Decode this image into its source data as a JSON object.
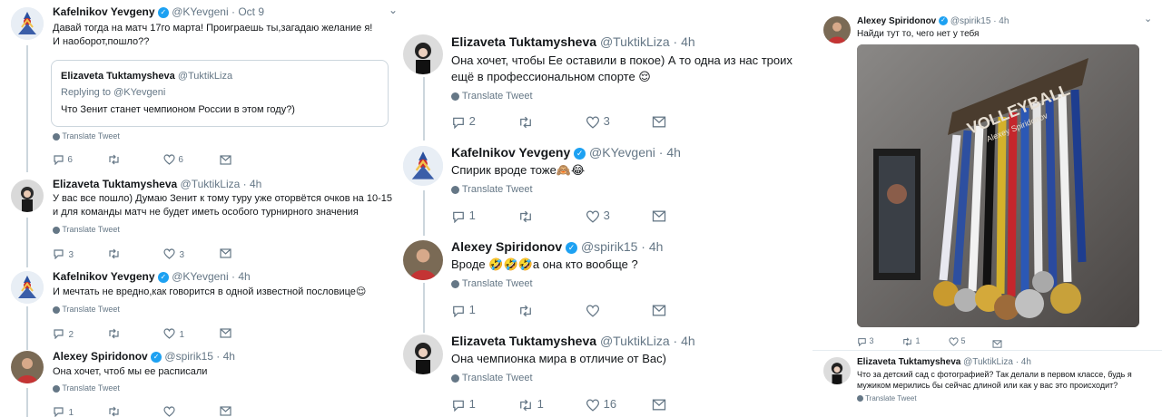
{
  "panel1": {
    "tweets": [
      {
        "name": "Kafelnikov Yevgeny",
        "handle": "@KYevgeni",
        "time": "· Oct 9",
        "text": "Давай тогда на матч 17го марта! Проиграешь ты,загадаю желание я! И наоборот,пошло??",
        "quote": {
          "name": "Elizaveta Tuktamysheva",
          "handle": "@TuktikLiza",
          "replying": "Replying to @KYevgeni",
          "text": "Что Зенит станет чемпионом России в этом году?)"
        },
        "translate": "Translate Tweet",
        "replies": "6",
        "retweets": "",
        "likes": "6"
      },
      {
        "name": "Elizaveta Tuktamysheva",
        "handle": "@TuktikLiza",
        "time": "· 4h",
        "text": "У вас все пошло) Думаю Зенит к тому туру уже оторвётся очков на 10-15 и для команды матч не будет иметь особого турнирного значения",
        "translate": "Translate Tweet",
        "replies": "3",
        "retweets": "",
        "likes": "3"
      },
      {
        "name": "Kafelnikov Yevgeny",
        "handle": "@KYevgeni",
        "time": "· 4h",
        "text": "И мечтать не вредно,как говорится в одной известной пословице😌",
        "translate": "Translate Tweet",
        "replies": "2",
        "retweets": "",
        "likes": "1"
      },
      {
        "name": "Alexey Spiridonov",
        "handle": "@spirik15",
        "time": "· 4h",
        "text": "Она хочет, чтоб мы ее расписали",
        "translate": "Translate Tweet",
        "replies": "1",
        "retweets": "",
        "likes": ""
      }
    ]
  },
  "panel2": {
    "tweets": [
      {
        "name": "Elizaveta Tuktamysheva",
        "handle": "@TuktikLiza",
        "time": "· 4h",
        "text": "Она хочет, чтобы Ее оставили в покое) А то одна из нас троих ещё в профессиональном спорте 😌",
        "translate": "Translate Tweet",
        "replies": "2",
        "retweets": "",
        "likes": "3"
      },
      {
        "name": "Kafelnikov Yevgeny",
        "handle": "@KYevgeni",
        "time": "· 4h",
        "text": "Спирик вроде тоже🙈😂",
        "translate": "Translate Tweet",
        "replies": "1",
        "retweets": "",
        "likes": "3"
      },
      {
        "name": "Alexey Spiridonov",
        "handle": "@spirik15",
        "time": "· 4h",
        "text": "Вроде 🤣🤣🤣а она кто вообще ?",
        "translate": "Translate Tweet",
        "replies": "1",
        "retweets": "",
        "likes": ""
      },
      {
        "name": "Elizaveta Tuktamysheva",
        "handle": "@TuktikLiza",
        "time": "· 4h",
        "text": "Она чемпионка мира в отличие от Вас)",
        "translate": "Translate Tweet",
        "replies": "1",
        "retweets": "1",
        "likes": "16"
      }
    ]
  },
  "panel3": {
    "tweet1": {
      "name": "Alexey Spiridonov",
      "handle": "@spirik15",
      "time": "· 4h",
      "text": "Найди тут то, чего нет у тебя",
      "photo_banner": "VOLLEYBALL",
      "photo_banner_sub": "Alexey Spiridonov",
      "replies": "3",
      "retweets": "1",
      "likes": "5"
    },
    "tweet2": {
      "name": "Elizaveta Tuktamysheva",
      "handle": "@TuktikLiza",
      "time": "· 4h",
      "text": "Что за детский сад с фотографией? Так делали в первом классе, будь я мужиком мерились бы сейчас длиной или как у вас это происходит?",
      "translate": "Translate Tweet"
    }
  },
  "icons": {
    "reply": "reply-icon",
    "retweet": "retweet-icon",
    "like": "heart-icon",
    "dm": "envelope-icon",
    "verified": "verified-badge-icon",
    "translate": "globe-icon",
    "caret": "chevron-down-icon"
  },
  "colors": {
    "verified": "#1da1f2",
    "muted": "#657786",
    "thread": "#ccd6dd"
  }
}
